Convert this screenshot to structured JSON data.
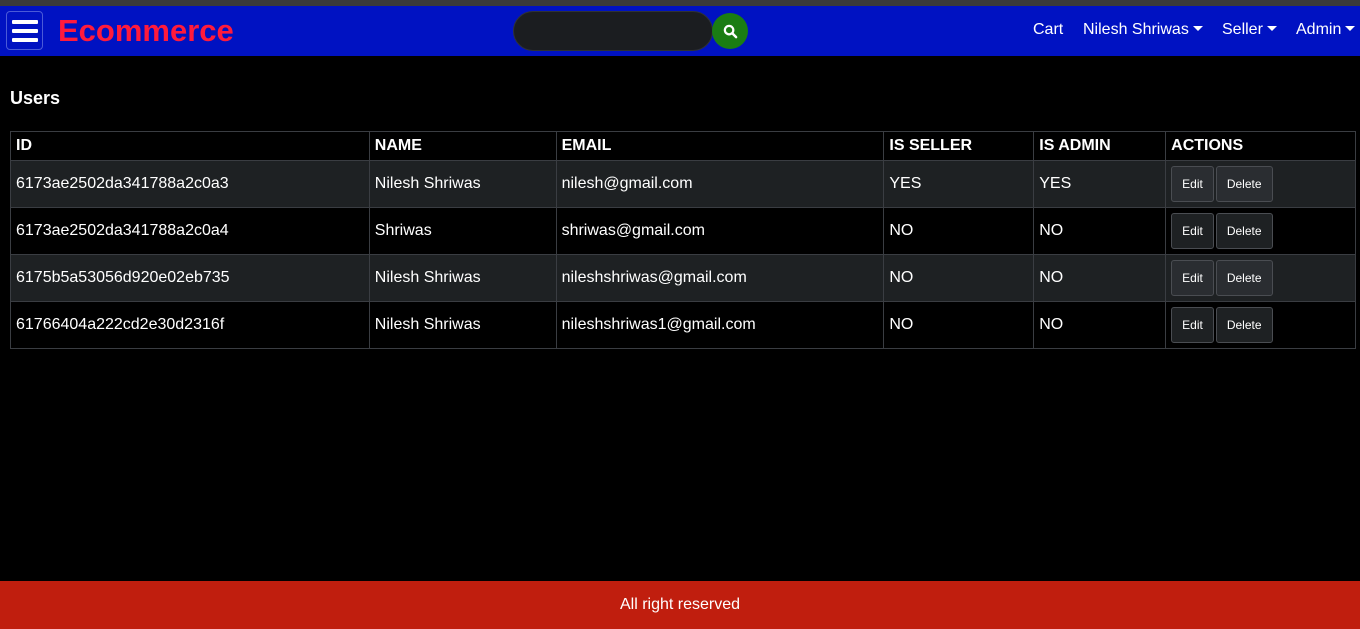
{
  "header": {
    "brand": "Ecommerce",
    "search": {
      "value": "",
      "placeholder": ""
    },
    "nav": {
      "cart": "Cart",
      "user": "Nilesh Shriwas",
      "seller": "Seller",
      "admin": "Admin"
    }
  },
  "main": {
    "title": "Users",
    "table": {
      "headers": [
        "ID",
        "NAME",
        "EMAIL",
        "IS SELLER",
        "IS ADMIN",
        "ACTIONS"
      ],
      "rows": [
        {
          "id": "6173ae2502da341788a2c0a3",
          "name": "Nilesh Shriwas",
          "email": "nilesh@gmail.com",
          "is_seller": "YES",
          "is_admin": "YES",
          "edit": "Edit",
          "delete": "Delete"
        },
        {
          "id": "6173ae2502da341788a2c0a4",
          "name": "Shriwas",
          "email": "shriwas@gmail.com",
          "is_seller": "NO",
          "is_admin": "NO",
          "edit": "Edit",
          "delete": "Delete"
        },
        {
          "id": "6175b5a53056d920e02eb735",
          "name": "Nilesh Shriwas",
          "email": "nileshshriwas@gmail.com",
          "is_seller": "NO",
          "is_admin": "NO",
          "edit": "Edit",
          "delete": "Delete"
        },
        {
          "id": "61766404a222cd2e30d2316f",
          "name": "Nilesh Shriwas",
          "email": "nileshshriwas1@gmail.com",
          "is_seller": "NO",
          "is_admin": "NO",
          "edit": "Edit",
          "delete": "Delete"
        }
      ]
    }
  },
  "footer": {
    "text": "All right reserved"
  },
  "icons": {
    "menu": "hamburger-menu-icon",
    "search": "search-icon",
    "caret": "caret-down-icon"
  },
  "colors": {
    "navbar": "#0012c2",
    "brand": "#ff1a3c",
    "search_button": "#1a7d13",
    "footer": "#c01e0e",
    "background": "#000000"
  }
}
